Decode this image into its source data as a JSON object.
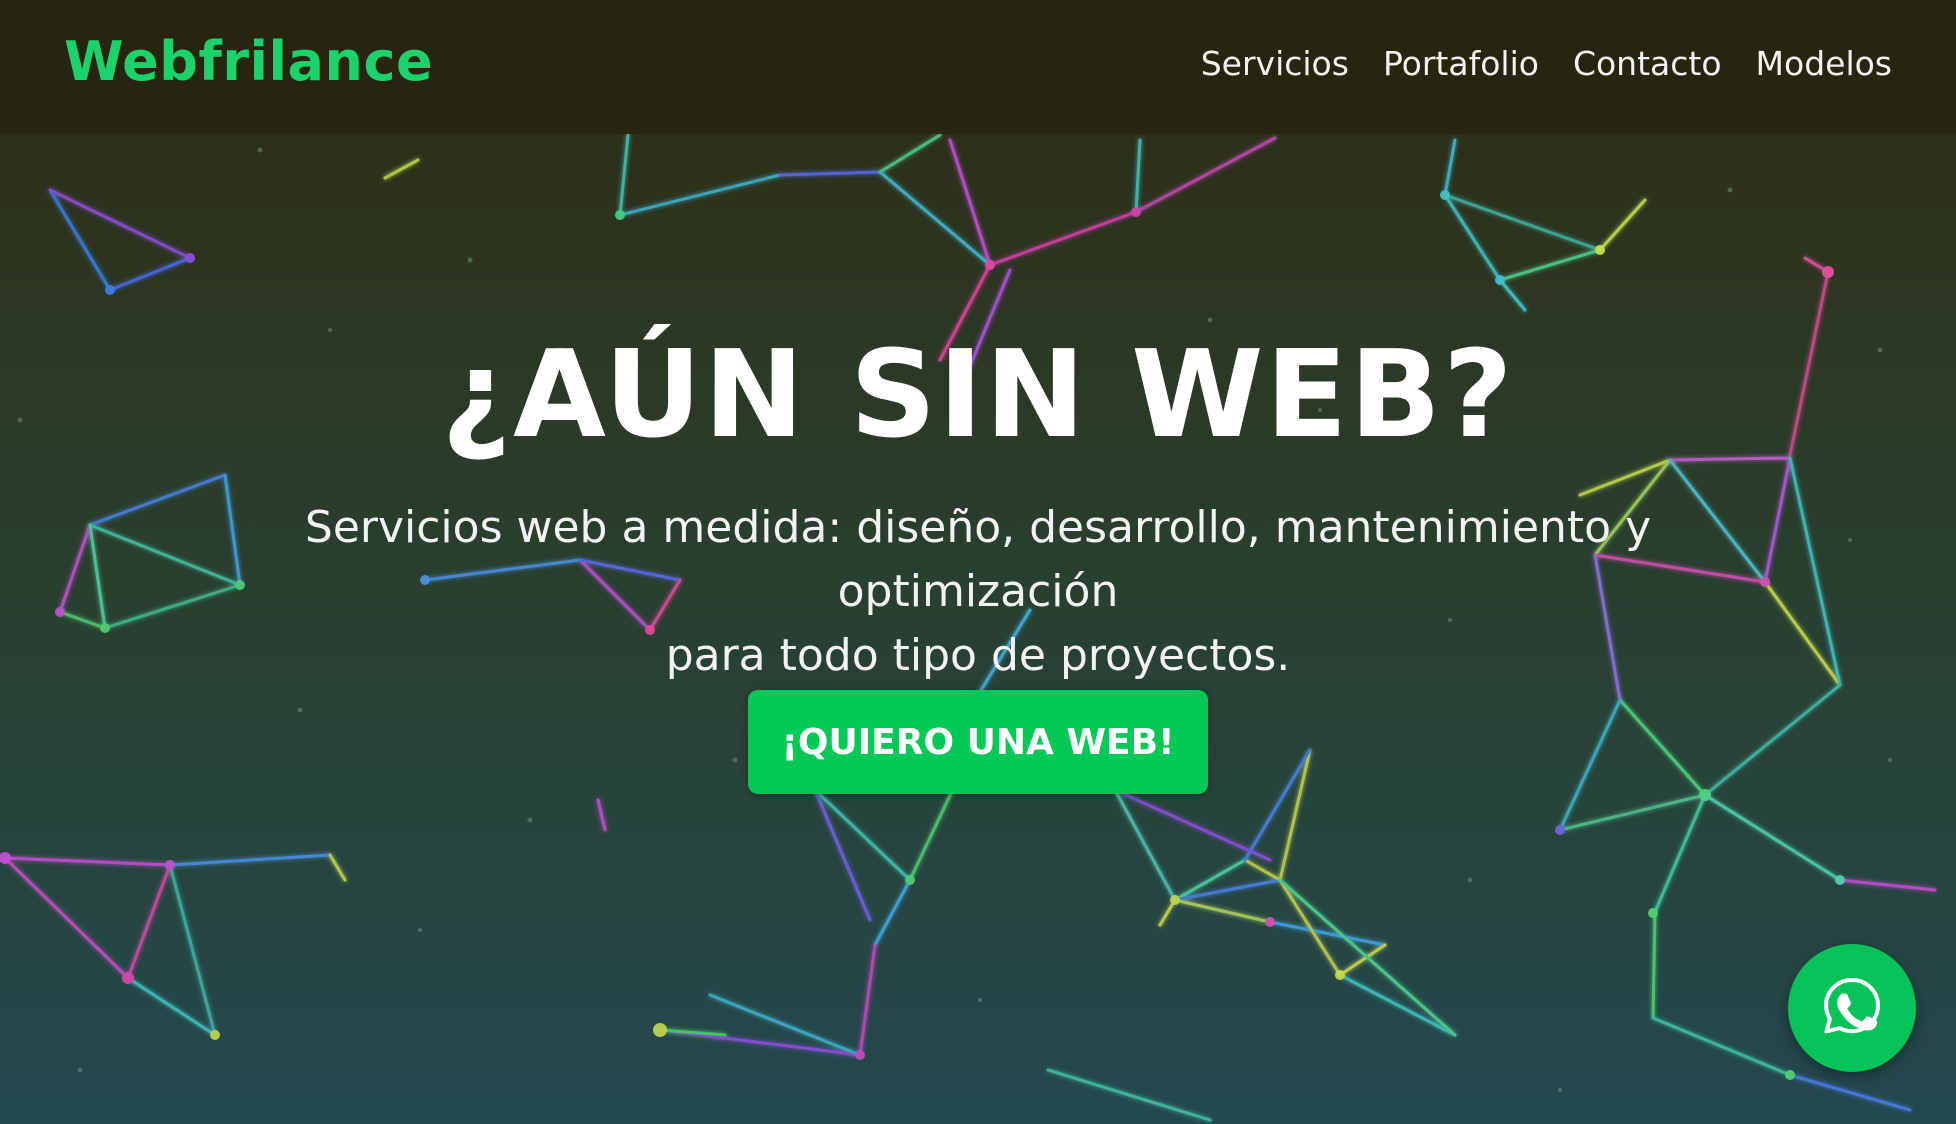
{
  "header": {
    "logo_text": "Webfrilance",
    "nav": [
      {
        "label": "Servicios"
      },
      {
        "label": "Portafolio"
      },
      {
        "label": "Contacto"
      },
      {
        "label": "Modelos"
      }
    ]
  },
  "hero": {
    "title": "¿AÚN SIN WEB?",
    "subtitle_line1": "Servicios web a medida: diseño, desarrollo, mantenimiento y optimización",
    "subtitle_line2": "para todo tipo de proyectos.",
    "cta_label": "¡QUIERO UNA WEB!"
  },
  "floating": {
    "whatsapp_icon": "whatsapp-icon"
  },
  "colors": {
    "brand_green": "#1ad36a",
    "button_green": "#04c957",
    "whatsapp_green": "#08c35a",
    "text_white": "#ffffff"
  }
}
